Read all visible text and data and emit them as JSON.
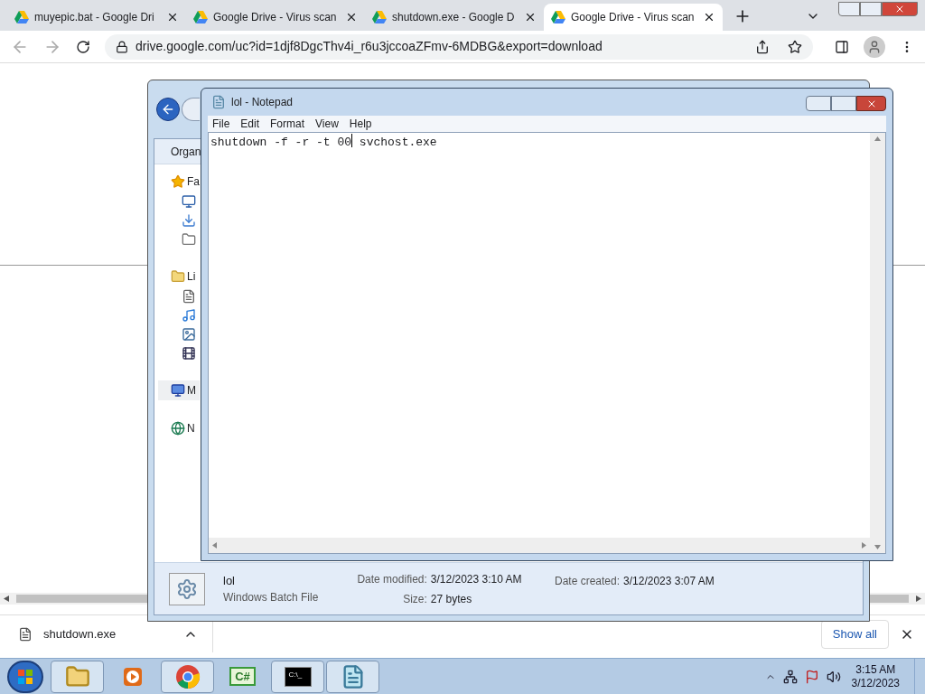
{
  "browser": {
    "tabs": [
      {
        "title": "muyepic.bat - Google Dri",
        "selected": false
      },
      {
        "title": "Google Drive - Virus scan",
        "selected": false
      },
      {
        "title": "shutdown.exe - Google D",
        "selected": false
      },
      {
        "title": "Google Drive - Virus scan",
        "selected": true
      }
    ],
    "address": "drive.google.com/uc?id=1djf8DgcThv4i_r6u3jccoaZFmv-6MDBG&export=download"
  },
  "explorer": {
    "toolbar_button": "Organ",
    "nav": [
      {
        "kind": "star",
        "label": "Fa",
        "selected": false,
        "children": [
          {
            "kind": "desktop",
            "selected": false
          },
          {
            "kind": "downloads",
            "selected": false
          },
          {
            "kind": "recent",
            "selected": false
          }
        ]
      },
      {
        "kind": "library",
        "label": "Li",
        "selected": false,
        "children": [
          {
            "kind": "document",
            "selected": false
          },
          {
            "kind": "music",
            "selected": false
          },
          {
            "kind": "pictures",
            "selected": false
          },
          {
            "kind": "video",
            "selected": false
          }
        ]
      },
      {
        "kind": "computer",
        "label": "M",
        "selected": true
      },
      {
        "kind": "network",
        "label": "N",
        "selected": false
      }
    ],
    "details": {
      "name": "lol",
      "type": "Windows Batch File",
      "fields": [
        {
          "label": "Date modified:",
          "value": "3/12/2023 3:10 AM"
        },
        {
          "label": "Size:",
          "value": "27 bytes"
        },
        {
          "label": "Date created:",
          "value": "3/12/2023 3:07 AM"
        }
      ]
    }
  },
  "notepad": {
    "title": "lol - Notepad",
    "menu": [
      "File",
      "Edit",
      "Format",
      "View",
      "Help"
    ],
    "text_before_caret": "shutdown -f -r -t 00",
    "text_after_caret": " svchost.exe"
  },
  "downloads": {
    "item": "shutdown.exe",
    "show_all": "Show all"
  },
  "taskbar": {
    "apps": [
      {
        "kind": "folder",
        "running": true
      },
      {
        "kind": "media",
        "running": false
      },
      {
        "kind": "chrome",
        "running": true
      },
      {
        "kind": "csharp",
        "label": "C#",
        "running": false
      },
      {
        "kind": "console",
        "label": "C:\\_",
        "running": true
      },
      {
        "kind": "notepad",
        "running": true
      }
    ],
    "time": "3:15 AM",
    "date": "3/12/2023"
  }
}
